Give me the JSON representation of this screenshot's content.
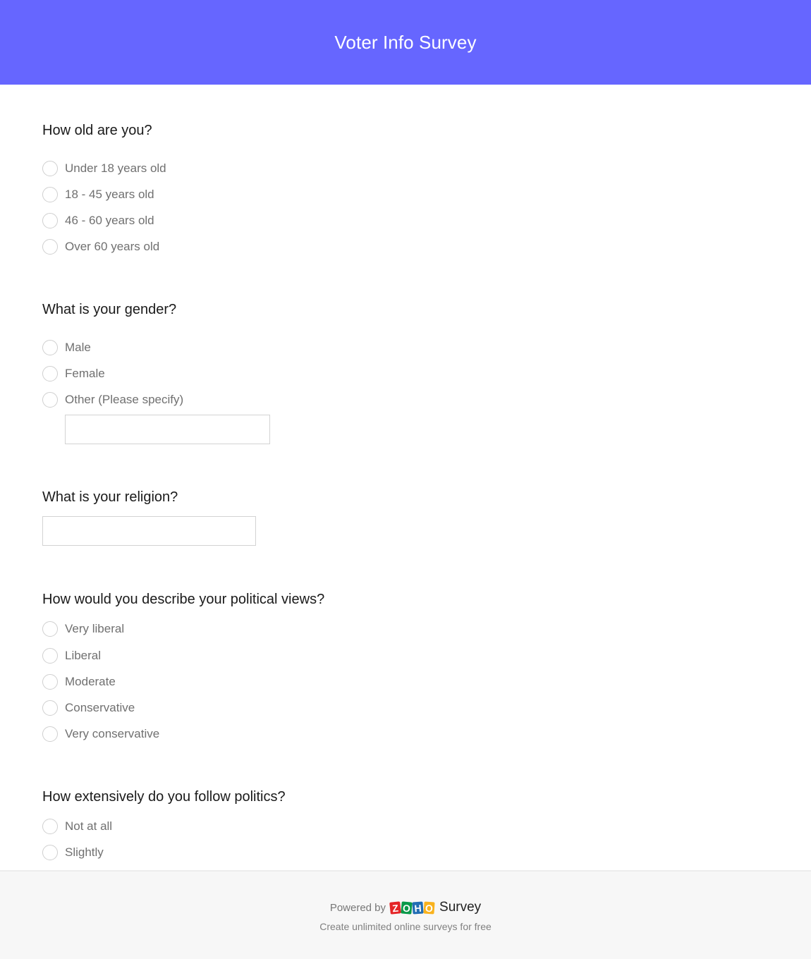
{
  "header": {
    "title": "Voter Info Survey",
    "background": "#6666ff"
  },
  "questions": [
    {
      "title": "How old are you?",
      "type": "radio",
      "options": [
        "Under 18 years old",
        "18 - 45 years old",
        "46 - 60 years old",
        "Over 60 years old"
      ]
    },
    {
      "title": "What is your gender?",
      "type": "radio",
      "options": [
        "Male",
        "Female",
        "Other (Please specify)"
      ],
      "other_input": {
        "value": "",
        "placeholder": ""
      }
    },
    {
      "title": "What is your religion?",
      "type": "text",
      "input": {
        "value": "",
        "placeholder": ""
      }
    },
    {
      "title": "How would you describe your political views?",
      "type": "radio",
      "options": [
        "Very liberal",
        "Liberal",
        "Moderate",
        "Conservative",
        "Very conservative"
      ]
    },
    {
      "title": "How extensively do you follow politics?",
      "type": "radio",
      "options": [
        "Not at all",
        "Slightly"
      ]
    }
  ],
  "footer": {
    "powered_by": "Powered by",
    "logo_letters": [
      "Z",
      "O",
      "H",
      "O"
    ],
    "brand": "Survey",
    "tagline": "Create unlimited online surveys for free"
  }
}
